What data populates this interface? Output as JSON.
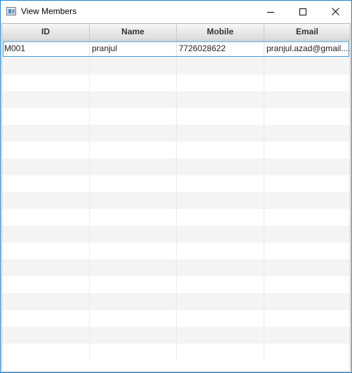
{
  "window": {
    "title": "View Members"
  },
  "table": {
    "columns": [
      "ID",
      "Name",
      "Mobile",
      "Email"
    ],
    "rows": [
      {
        "id": "M001",
        "name": "pranjul",
        "mobile": "7726028622",
        "email": "pranjul.azad@gmail...."
      }
    ],
    "empty_row_count": 18
  },
  "colors": {
    "window_border": "#1883d7",
    "selection_outline": "#3a97d9",
    "header_bg": "#e4e4e4",
    "alt_row_bg": "#f4f4f4"
  },
  "icons": {
    "app": "window-app-icon",
    "minimize": "minimize-icon",
    "maximize": "maximize-icon",
    "close": "close-icon"
  }
}
